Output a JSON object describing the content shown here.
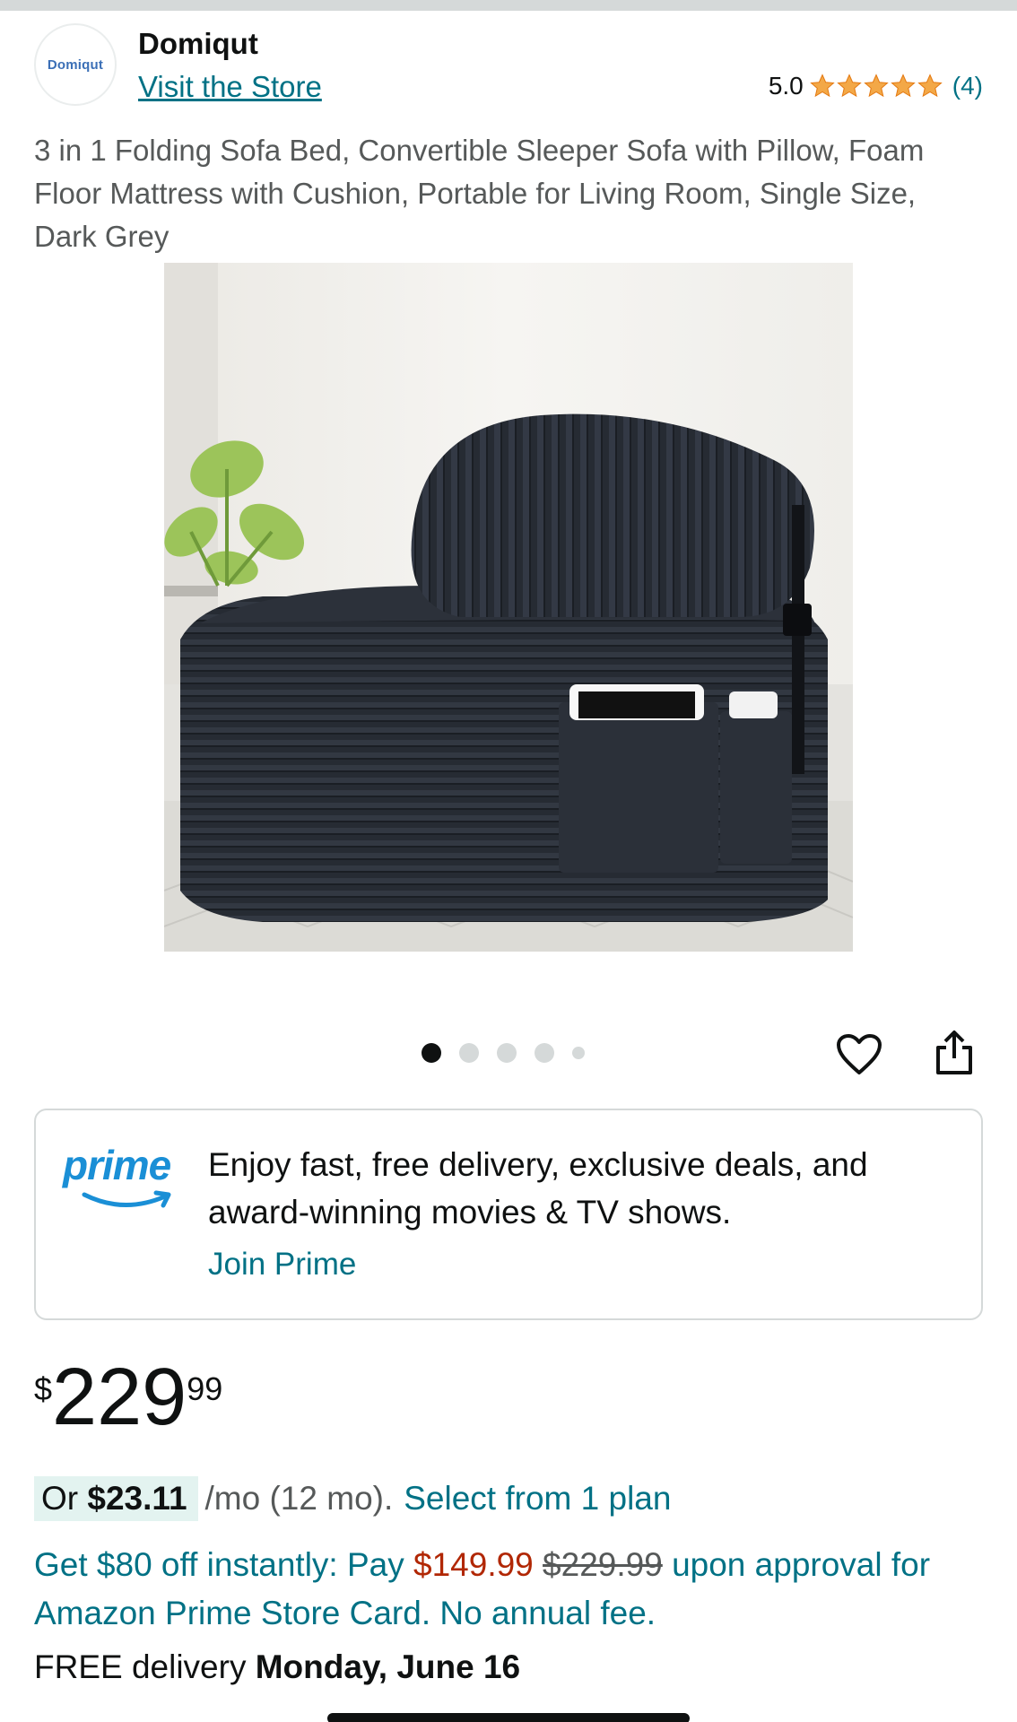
{
  "store": {
    "logo_text": "Domiqut",
    "name": "Domiqut",
    "visit_link": "Visit the Store",
    "rating_value": "5.0",
    "rating_stars": 5,
    "rating_count": "(4)"
  },
  "product": {
    "title": "3 in 1 Folding Sofa Bed, Convertible Sleeper Sofa with Pillow, Foam Floor Mattress with Cushion, Portable for Living Room, Single Size, Dark Grey",
    "image_count": 5,
    "active_image": 1
  },
  "icons": {
    "wishlist": "heart-icon",
    "share": "share-icon",
    "star": "star-icon"
  },
  "prime": {
    "logo_text": "prime",
    "message": "Enjoy fast, free delivery, exclusive deals, and award-winning movies & TV shows.",
    "cta": "Join Prime"
  },
  "price": {
    "symbol": "$",
    "whole": "229",
    "fraction": "99"
  },
  "monthly": {
    "prefix": "Or",
    "amount": "$23.11",
    "suffix": "/mo (12 mo).",
    "link": "Select from 1 plan"
  },
  "offer": {
    "prefix": "Get $80 off instantly: Pay",
    "discounted_price": "$149.99",
    "original_price": "$229.99",
    "suffix": "upon approval for Amazon Prime Store Card. No annual fee."
  },
  "delivery": {
    "prefix": "FREE delivery",
    "date": "Monday, June 16"
  },
  "colors": {
    "link": "#007185",
    "price_red": "#b12704",
    "star": "#f3a847",
    "prime_blue": "#1a8fd6",
    "highlight": "#e3f3f0"
  }
}
